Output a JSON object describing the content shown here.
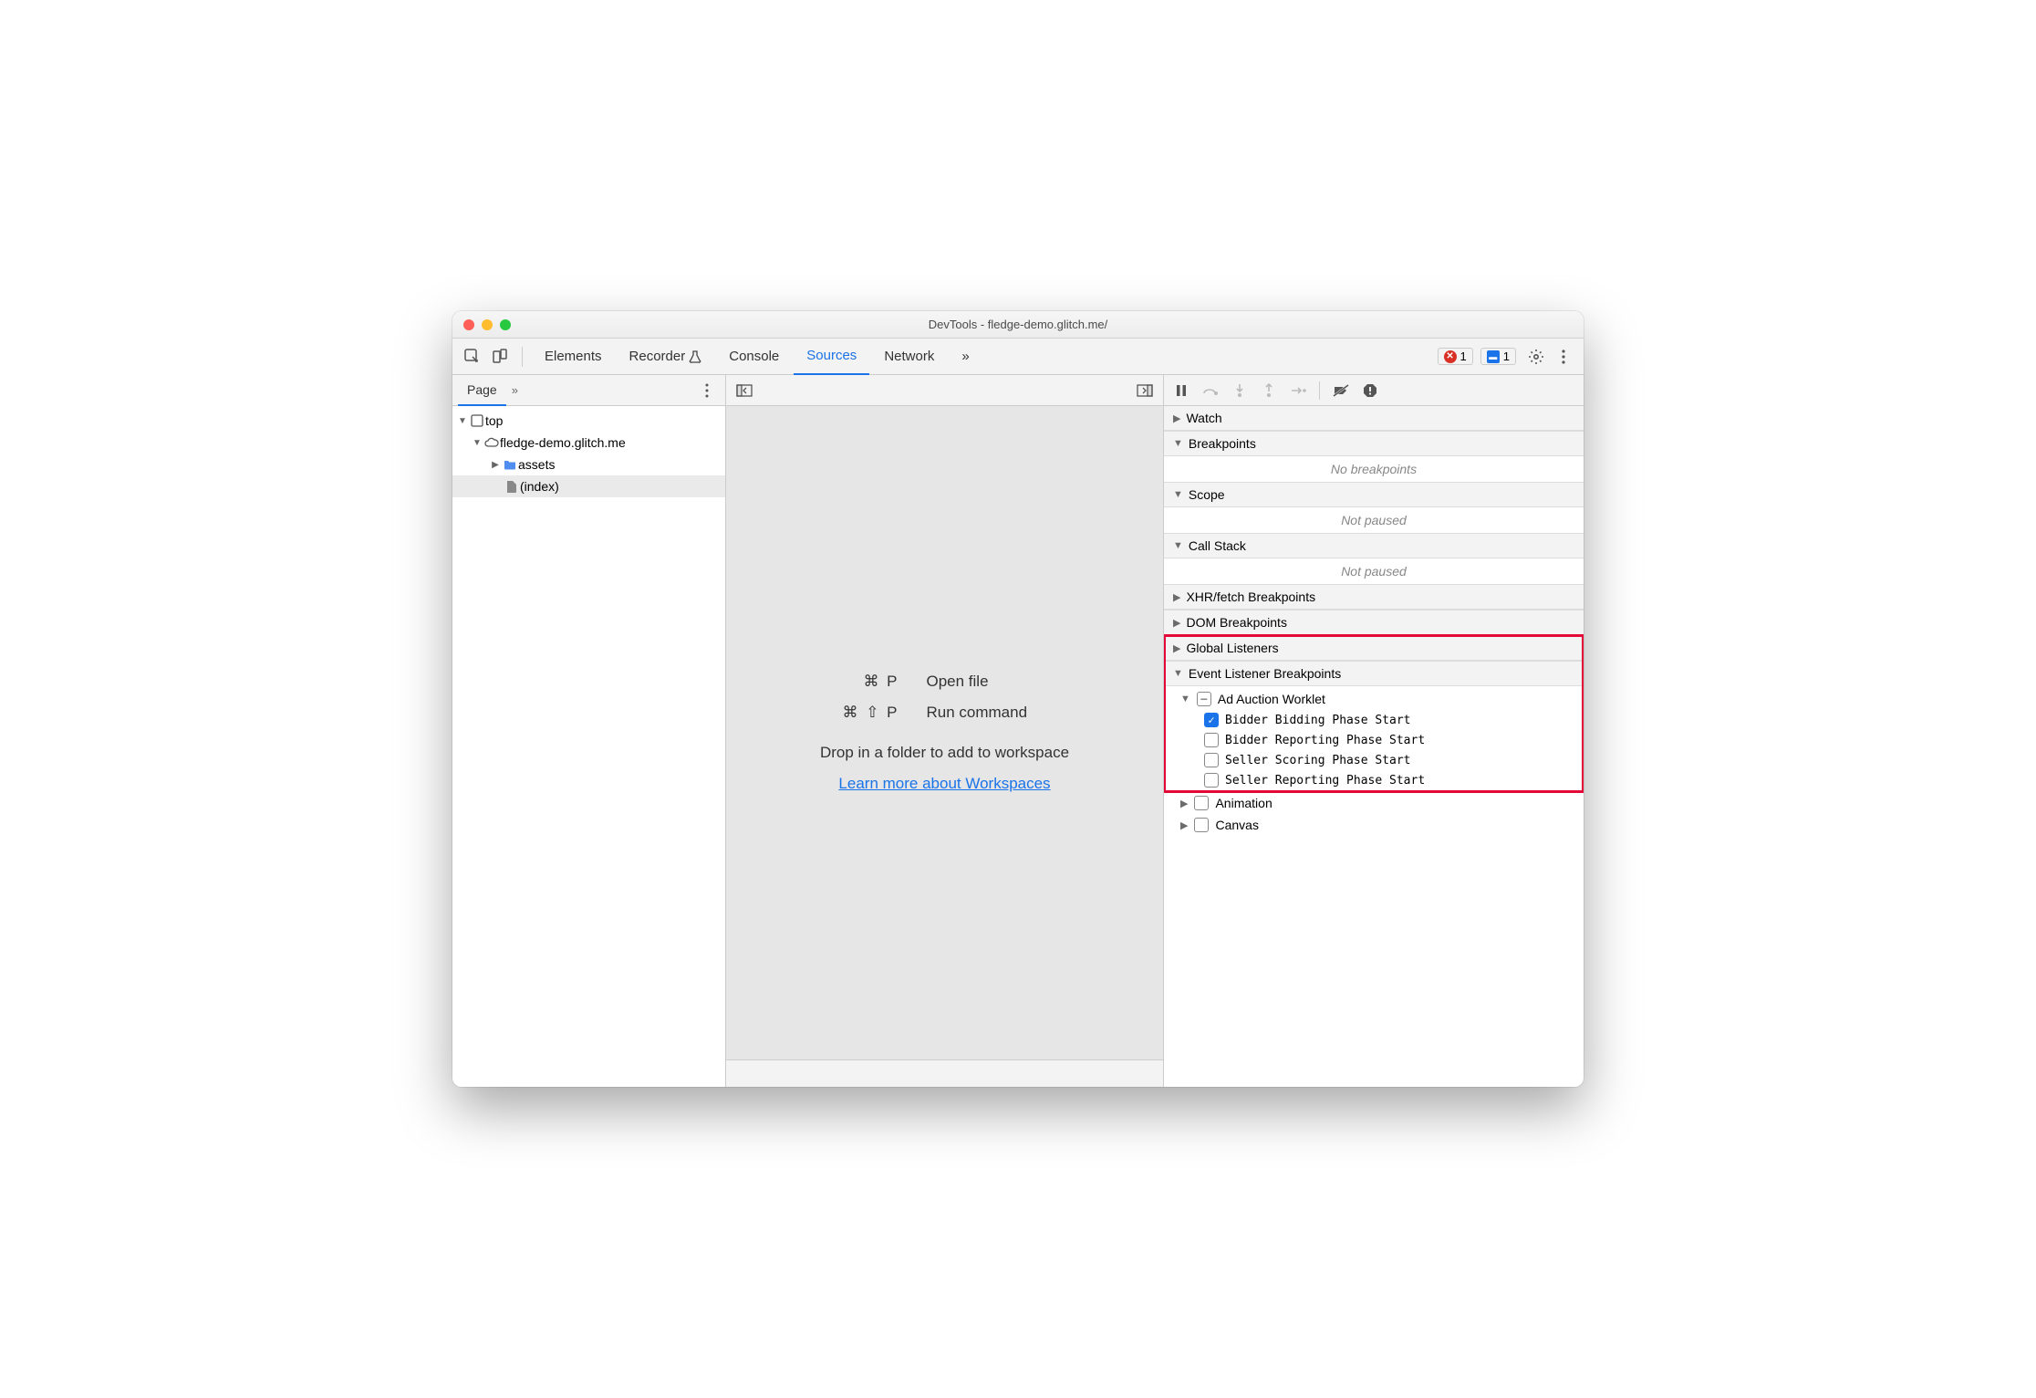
{
  "window": {
    "title": "DevTools - fledge-demo.glitch.me/"
  },
  "tabs": {
    "items": [
      "Elements",
      "Recorder",
      "Console",
      "Sources",
      "Network"
    ],
    "active": "Sources",
    "overflow": "»"
  },
  "statusbar": {
    "errors": "1",
    "issues": "1"
  },
  "left": {
    "tab": "Page",
    "overflow": "»",
    "tree": {
      "top": "top",
      "domain": "fledge-demo.glitch.me",
      "folder": "assets",
      "file": "(index)"
    }
  },
  "mid": {
    "shortcuts": {
      "openfile_key": "⌘ P",
      "openfile_lab": "Open file",
      "runcmd_key": "⌘ ⇧ P",
      "runcmd_lab": "Run command"
    },
    "drop": "Drop in a folder to add to workspace",
    "learn": "Learn more about Workspaces"
  },
  "right": {
    "sections": {
      "watch": "Watch",
      "breakpoints": "Breakpoints",
      "breakpoints_empty": "No breakpoints",
      "scope": "Scope",
      "scope_empty": "Not paused",
      "callstack": "Call Stack",
      "callstack_empty": "Not paused",
      "xhr": "XHR/fetch Breakpoints",
      "dom": "DOM Breakpoints",
      "global": "Global Listeners",
      "elbp": "Event Listener Breakpoints",
      "animation": "Animation",
      "canvas": "Canvas"
    },
    "adauction": {
      "category": "Ad Auction Worklet",
      "events": [
        {
          "label": "Bidder Bidding Phase Start",
          "checked": true
        },
        {
          "label": "Bidder Reporting Phase Start",
          "checked": false
        },
        {
          "label": "Seller Scoring Phase Start",
          "checked": false
        },
        {
          "label": "Seller Reporting Phase Start",
          "checked": false
        }
      ]
    }
  }
}
